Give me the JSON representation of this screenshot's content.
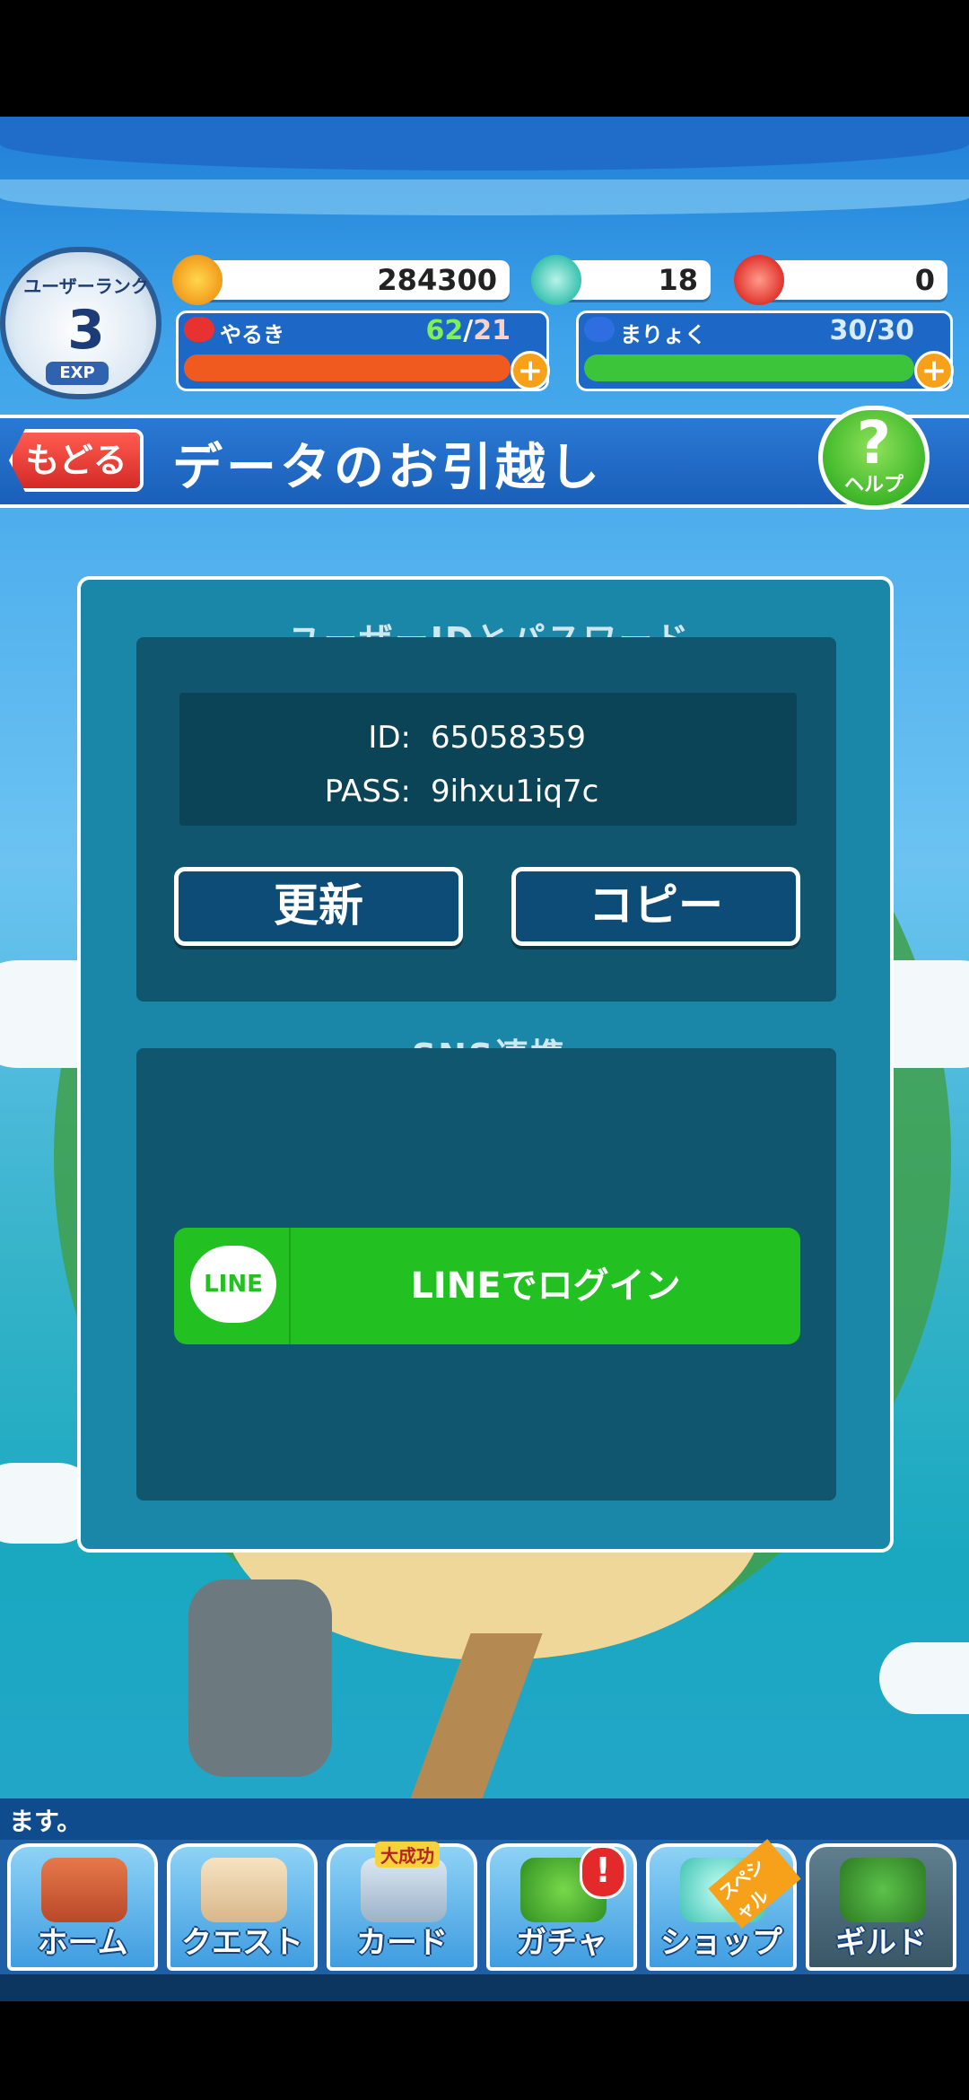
{
  "status": {
    "rank_label": "ユーザーランク",
    "rank_value": "3",
    "exp_label": "EXP",
    "coins": "284300",
    "gems": "18",
    "tickets": "0",
    "stamina": {
      "label": "やるき",
      "current": "62",
      "max": "21",
      "fill_fraction": 1.0
    },
    "mana": {
      "label": "まりょく",
      "current": "30",
      "max": "30",
      "fill_fraction": 1.0
    },
    "plus": "+"
  },
  "header": {
    "back_label": "もどる",
    "title": "データのお引越し",
    "help_mark": "?",
    "help_label": "ヘルプ"
  },
  "credentials": {
    "section_title": "ユーザーIDとパスワード",
    "id_label": "ID:",
    "id_value": "65058359",
    "pass_label": "PASS:",
    "pass_value": "9ihxu1iq7c",
    "refresh_button": "更新",
    "copy_button": "コピー"
  },
  "sns": {
    "section_title": "SNS連携",
    "line_logo": "LINE",
    "line_button": "LINEでログイン"
  },
  "ticker": "ます。",
  "nav": {
    "tabs": [
      {
        "label": "ホーム"
      },
      {
        "label": "クエスト"
      },
      {
        "label": "カード",
        "ribbon": "大成功"
      },
      {
        "label": "ガチャ",
        "badge": "!"
      },
      {
        "label": "ショップ",
        "ribbon": "スペシャル"
      },
      {
        "label": "ギルド"
      }
    ]
  },
  "colors": {
    "stamina_bar": "#f05a1e",
    "mana_bar": "#3cc53a",
    "line_green": "#22c021",
    "dialog_bg": "#1a86a8"
  }
}
